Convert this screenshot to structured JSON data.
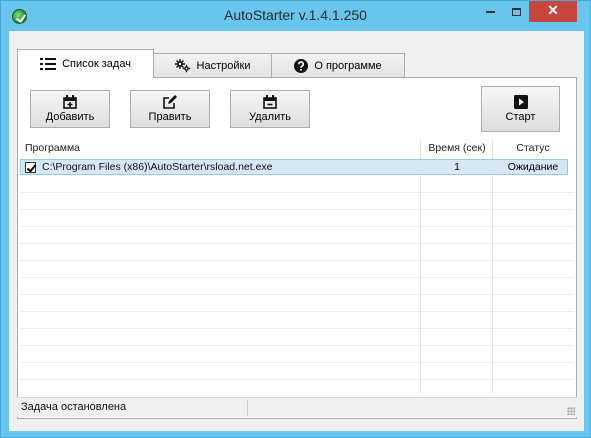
{
  "window": {
    "title": "AutoStarter v.1.4.1.250",
    "app_icon": "app-logo-icon",
    "controls": {
      "minimize": "minimize-icon",
      "maximize": "maximize-icon",
      "close": "✕"
    }
  },
  "tabs": [
    {
      "label": "Список задач",
      "icon": "list-icon",
      "active": true
    },
    {
      "label": "Настройки",
      "icon": "gears-icon",
      "active": false
    },
    {
      "label": "О программе",
      "icon": "question-icon",
      "active": false
    }
  ],
  "toolbar": {
    "add_label": "Добавить",
    "edit_label": "Править",
    "delete_label": "Удалить",
    "start_label": "Старт"
  },
  "grid": {
    "columns": [
      "Программа",
      "Время (сек)",
      "Статус"
    ],
    "rows": [
      {
        "checked": true,
        "program": "C:\\Program Files (x86)\\AutoStarter\\rsload.net.exe",
        "time": "1",
        "status": "Ожидание"
      }
    ]
  },
  "statusbar": {
    "text": "Задача остановлена"
  },
  "colors": {
    "frame": "#67c5ee",
    "close": "#c7463e",
    "selection": "#d7e8f5"
  }
}
